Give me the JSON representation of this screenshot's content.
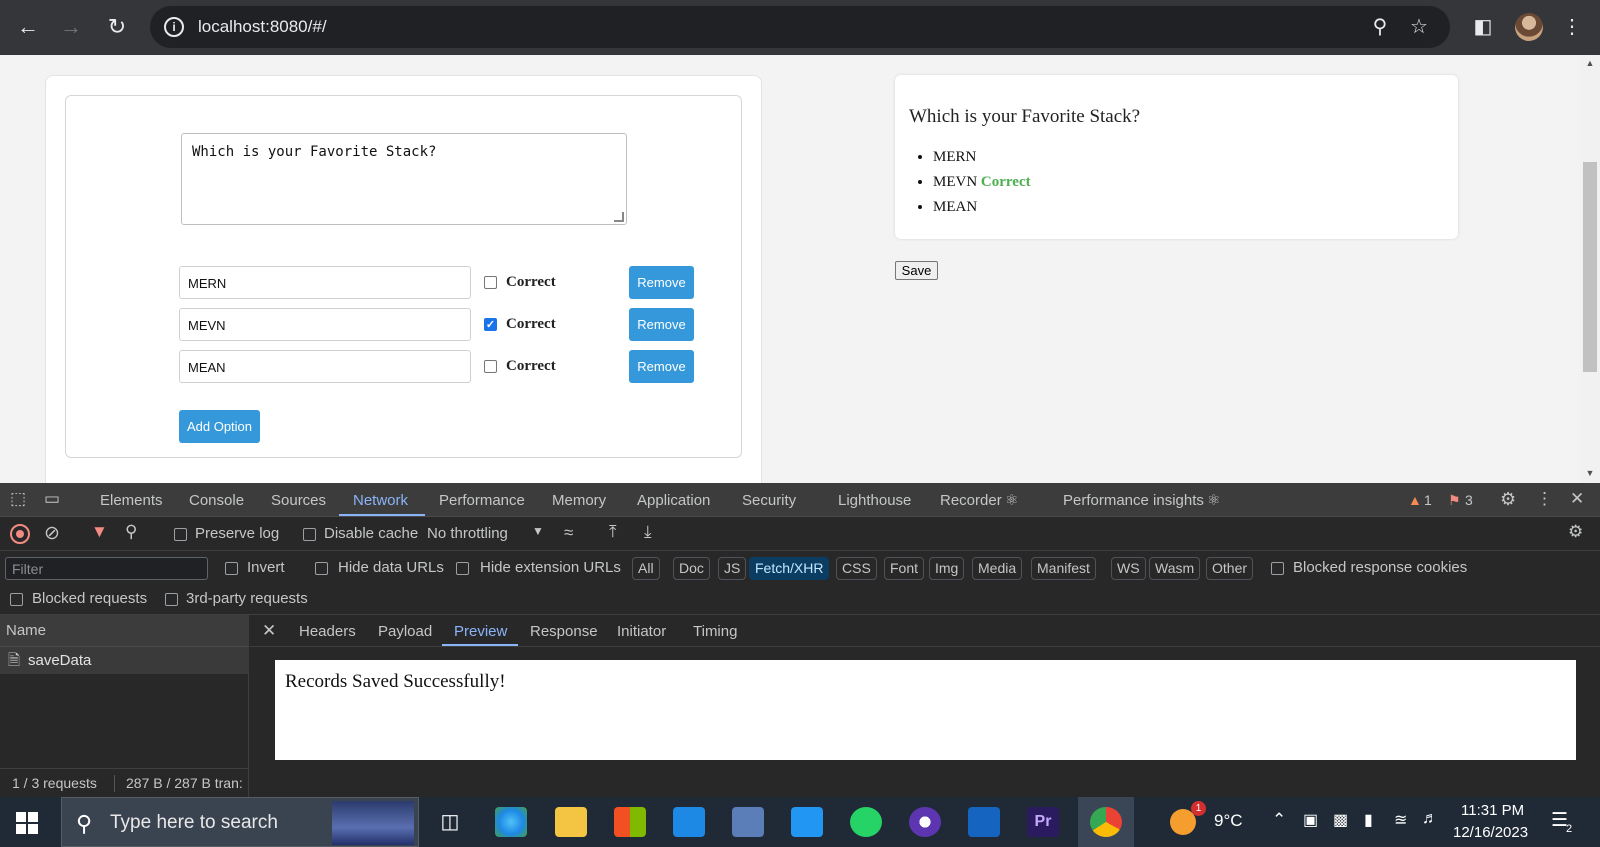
{
  "browser": {
    "url": "localhost:8080/#/",
    "icons": [
      "back-icon",
      "forward-icon",
      "reload-icon",
      "site-info-icon",
      "zoom-icon",
      "bookmark-star-icon",
      "side-panel-icon",
      "profile-avatar",
      "chrome-menu-icon"
    ]
  },
  "editor": {
    "question": "Which is your Favorite Stack?",
    "options": [
      {
        "value": "MERN",
        "checked": false
      },
      {
        "value": "MEVN",
        "checked": true
      },
      {
        "value": "MEAN",
        "checked": false
      }
    ],
    "correct_label": "Correct",
    "remove_label": "Remove",
    "add_option_label": "Add Option"
  },
  "preview": {
    "question": "Which is your Favorite Stack?",
    "options": [
      "MERN",
      "MEVN",
      "MEAN"
    ],
    "correct_tag": "Correct",
    "save_label": "Save"
  },
  "devtools": {
    "tabs": [
      "Elements",
      "Console",
      "Sources",
      "Network",
      "Performance",
      "Memory",
      "Application",
      "Security",
      "Lighthouse",
      "Recorder",
      "Performance insights"
    ],
    "active_tab": "Network",
    "warnings": "1",
    "errors": "3",
    "toolbar": {
      "preserve_log": "Preserve log",
      "disable_cache": "Disable cache",
      "throttling": "No throttling"
    },
    "filter": {
      "placeholder": "Filter",
      "invert": "Invert",
      "hide_data_urls": "Hide data URLs",
      "hide_extension_urls": "Hide extension URLs",
      "chips": [
        "All",
        "Doc",
        "JS",
        "Fetch/XHR",
        "CSS",
        "Font",
        "Img",
        "Media",
        "Manifest",
        "WS",
        "Wasm",
        "Other"
      ],
      "selected_chip": "Fetch/XHR",
      "blocked_response_cookies": "Blocked response cookies",
      "blocked_requests": "Blocked requests",
      "third_party_requests": "3rd-party requests"
    },
    "requests": {
      "name_header": "Name",
      "items": [
        "saveData"
      ],
      "summary_count": "1 / 3 requests",
      "summary_size": "287 B / 287 B tran:"
    },
    "detail": {
      "tabs": [
        "Headers",
        "Payload",
        "Preview",
        "Response",
        "Initiator",
        "Timing"
      ],
      "active_tab": "Preview",
      "preview_text": "Records Saved Successfully!"
    }
  },
  "taskbar": {
    "search_placeholder": "Type here to search",
    "weather": "9°C",
    "weather_badge": "1",
    "time": "11:31 PM",
    "date": "12/16/2023",
    "notification_count": "2"
  },
  "colors": {
    "accent_blue": "#3498db",
    "correct_green": "#4caf50",
    "devtools_active": "#8ab4f8"
  }
}
